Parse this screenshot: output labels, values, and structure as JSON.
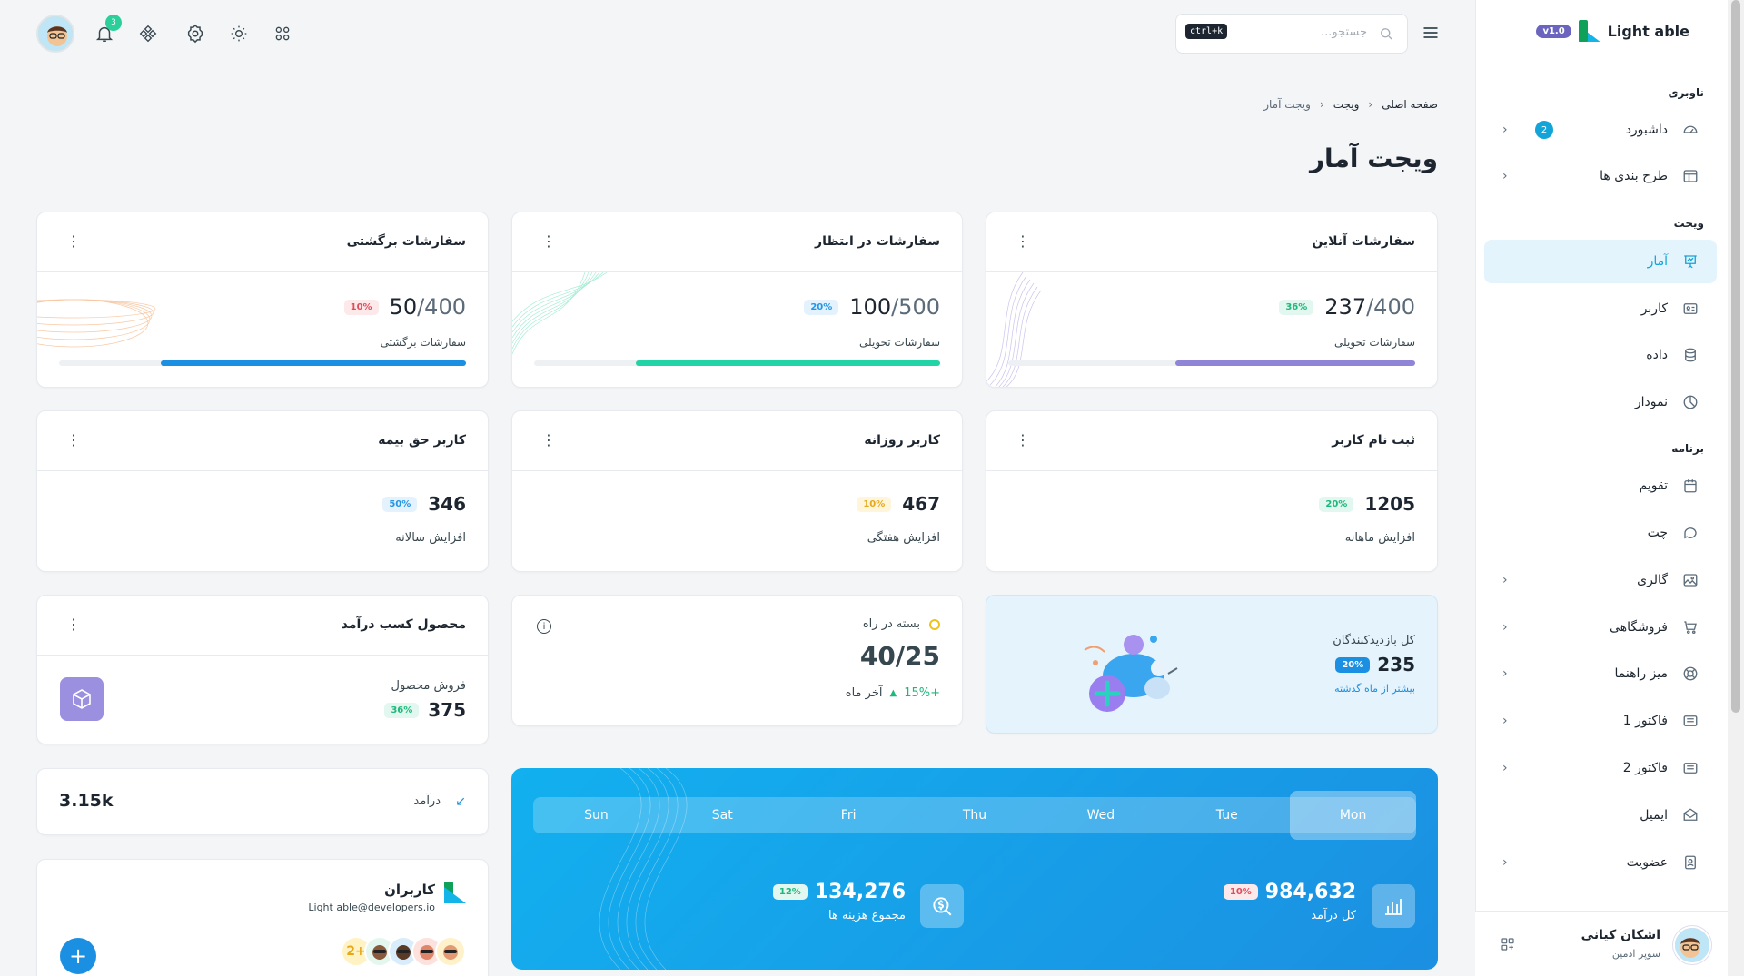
{
  "sidebar": {
    "logo_text": "Light able",
    "version": "v1.0",
    "sections": {
      "nav": "ناوبری",
      "widget": "ویجت",
      "app": "برنامه"
    },
    "items": [
      {
        "label": "داشبورد",
        "icon": "dashboard-icon",
        "badge": "2",
        "chevron": true
      },
      {
        "label": "طرح بندی ها",
        "icon": "layout-icon",
        "chevron": true
      },
      {
        "label": "آمار",
        "icon": "presentation-icon",
        "active": true
      },
      {
        "label": "کاربر",
        "icon": "user-card-icon"
      },
      {
        "label": "داده",
        "icon": "database-icon"
      },
      {
        "label": "نمودار",
        "icon": "pie-chart-icon"
      },
      {
        "label": "تقویم",
        "icon": "calendar-icon"
      },
      {
        "label": "چت",
        "icon": "chat-icon"
      },
      {
        "label": "گالری",
        "icon": "gallery-icon",
        "chevron": true
      },
      {
        "label": "فروشگاهی",
        "icon": "cart-icon",
        "chevron": true
      },
      {
        "label": "میز راهنما",
        "icon": "lifebuoy-icon",
        "chevron": true
      },
      {
        "label": "فاکتور 1",
        "icon": "invoice-icon",
        "chevron": true
      },
      {
        "label": "فاکتور 2",
        "icon": "invoice-icon",
        "chevron": true
      },
      {
        "label": "ایمیل",
        "icon": "mail-icon"
      },
      {
        "label": "عضویت",
        "icon": "membership-icon",
        "chevron": true
      }
    ],
    "user": {
      "name": "اشکان کیانی",
      "role": "سوپر ادمین"
    }
  },
  "topbar": {
    "search_placeholder": "جستجو...",
    "search_shortcut": "ctrl+k",
    "notif_count": "3"
  },
  "breadcrumb": [
    "صفحه اصلی",
    "ویجت",
    "ویجت آمار"
  ],
  "page_title": "ویجت آمار",
  "orders": [
    {
      "title": "سفارشات آنلاین",
      "value": "237",
      "total": "/400",
      "pct": "36%",
      "pct_color": "green",
      "sub": "سفارشات تحویلی",
      "bar_color": "#8e85d8",
      "progress_pct": 59
    },
    {
      "title": "سفارشات در انتظار",
      "value": "100",
      "total": "/500",
      "pct": "20%",
      "pct_color": "blue",
      "sub": "سفارشات تحویلی",
      "bar_color": "#22d3a6",
      "progress_pct": 75
    },
    {
      "title": "سفارشات برگشتی",
      "value": "50",
      "total": "/400",
      "pct": "10%",
      "pct_color": "red",
      "sub": "سفارشات برگشتی",
      "bar_color": "#1b8fe1",
      "progress_pct": 75
    }
  ],
  "users_stats": [
    {
      "title": "ثبت نام کاربر",
      "value": "1205",
      "pct": "20%",
      "pct_color": "green",
      "sub": "افزایش ماهانه"
    },
    {
      "title": "کاربر روزانه",
      "value": "467",
      "pct": "10%",
      "pct_color": "yellow",
      "sub": "افزایش هفتگی"
    },
    {
      "title": "کاربر حق بیمه",
      "value": "346",
      "pct": "50%",
      "pct_color": "blue",
      "sub": "افزایش سالانه"
    }
  ],
  "visitors": {
    "title": "کل بازدیدکنندگان",
    "value": "235",
    "pct": "20%",
    "link": "بیشتر از ماه گذشته"
  },
  "package": {
    "title": "بسته در راه",
    "value": "40/25",
    "trend": "+15%",
    "period": "آخر ماه"
  },
  "product": {
    "title": "محصول کسب درآمد",
    "label": "فروش محصول",
    "value": "375",
    "pct": "36%"
  },
  "revenue_small": {
    "label": "درآمد",
    "value": "3.15k"
  },
  "weekly": {
    "days": [
      "Mon",
      "Tue",
      "Wed",
      "Thu",
      "Fri",
      "Sat",
      "Sun"
    ],
    "selected": "Mon",
    "total_income": {
      "value": "984,632",
      "pct": "10%",
      "label": "کل درآمد"
    },
    "total_cost": {
      "value": "134,276",
      "pct": "12%",
      "label": "مجموع هزینه ها"
    }
  },
  "users_card": {
    "title": "کاربران",
    "email": "Light able@developers.io",
    "more": "2+"
  }
}
